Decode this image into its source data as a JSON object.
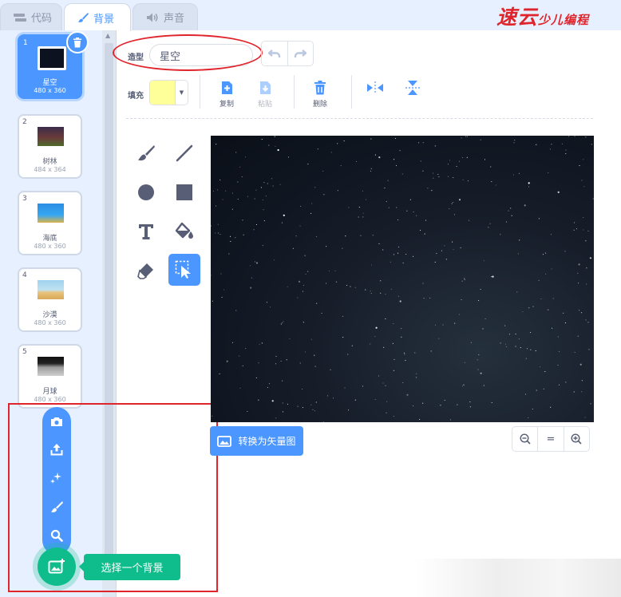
{
  "tabs": {
    "code": "代码",
    "backdrops": "背景",
    "sounds": "声音"
  },
  "logo": {
    "main": "速云",
    "sub": "少儿编程"
  },
  "costumes": [
    {
      "num": "1",
      "name": "星空",
      "dims": "480 x 360",
      "selected": true
    },
    {
      "num": "2",
      "name": "树林",
      "dims": "484 x 364"
    },
    {
      "num": "3",
      "name": "海底",
      "dims": "480 x 360"
    },
    {
      "num": "4",
      "name": "沙漠",
      "dims": "480 x 360"
    },
    {
      "num": "5",
      "name": "月球",
      "dims": "480 x 360"
    }
  ],
  "editor": {
    "name_label": "造型",
    "name_value": "星空",
    "fill_label": "填充",
    "fill_color": "#ffff99",
    "copy": "复制",
    "paste": "粘贴",
    "delete": "删除",
    "convert_button": "转换为矢量图",
    "zoom_reset": "="
  },
  "add_menu": {
    "tooltip": "选择一个背景"
  },
  "colors": {
    "accent": "#4c97ff",
    "green": "#0fbd8c",
    "annotation_red": "#e0242b"
  }
}
